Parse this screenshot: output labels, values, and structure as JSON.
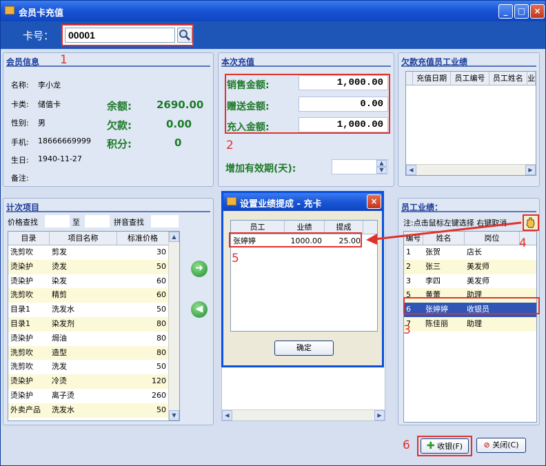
{
  "window": {
    "title": "会员卡充值",
    "min": "_",
    "max": "□",
    "close": "×"
  },
  "card": {
    "label": "卡号：",
    "value": "00001"
  },
  "member": {
    "header": "会员信息",
    "name": {
      "label": "名称:",
      "value": "李小龙"
    },
    "type": {
      "label": "卡类:",
      "value": "储值卡"
    },
    "gender": {
      "label": "性别:",
      "value": "男"
    },
    "phone": {
      "label": "手机:",
      "value": "18666669999"
    },
    "birthday": {
      "label": "生日:",
      "value": "1940-11-27"
    },
    "note": {
      "label": "备注:"
    },
    "balance": {
      "label": "余额:",
      "value": "2690.00"
    },
    "debt": {
      "label": "欠款:",
      "value": "0.00"
    },
    "points": {
      "label": "积分:",
      "value": "0"
    }
  },
  "recharge": {
    "header": "本次充值",
    "sales": {
      "label": "销售金额:",
      "value": "1,000.00"
    },
    "gift": {
      "label": "赠送金额:",
      "value": "0.00"
    },
    "credit": {
      "label": "充入金额:",
      "value": "1,000.00"
    },
    "validity_label": "增加有效期(天):",
    "validity_value": ""
  },
  "arrears": {
    "header": "欠款充值员工业绩",
    "columns": [
      "充值日期",
      "员工编号",
      "员工姓名",
      "业"
    ]
  },
  "items": {
    "header": "计次项目",
    "price_search": "价格查找",
    "to": "至",
    "pinyin_search": "拼音查找",
    "columns": [
      "目录",
      "项目名称",
      "标准价格"
    ],
    "rows": [
      [
        "洗剪吹",
        "剪发",
        "30"
      ],
      [
        "烫染护",
        "烫发",
        "50"
      ],
      [
        "烫染护",
        "染发",
        "60"
      ],
      [
        "洗剪吹",
        "精剪",
        "60"
      ],
      [
        "目录1",
        "洗发水",
        "50"
      ],
      [
        "目录1",
        "染发剂",
        "80"
      ],
      [
        "烫染护",
        "焗油",
        "80"
      ],
      [
        "洗剪吹",
        "造型",
        "80"
      ],
      [
        "洗剪吹",
        "洗发",
        "50"
      ],
      [
        "烫染护",
        "冷烫",
        "120"
      ],
      [
        "烫染护",
        "离子烫",
        "260"
      ],
      [
        "外卖产品",
        "洗发水",
        "50"
      ]
    ]
  },
  "staff": {
    "header": "员工业绩：",
    "hint": "注:点击鼠标左键选择 右键取消",
    "columns": [
      "编号",
      "姓名",
      "岗位"
    ],
    "rows": [
      [
        "1",
        "张贺",
        "店长"
      ],
      [
        "2",
        "张三",
        "美发师"
      ],
      [
        "3",
        "李四",
        "美发师"
      ],
      [
        "5",
        "黄蕾",
        "助理"
      ],
      [
        "6",
        "张婷婷",
        "收银员"
      ],
      [
        "7",
        "陈佳丽",
        "助理"
      ]
    ]
  },
  "dialog": {
    "title": "设置业绩提成 - 充卡",
    "columns": [
      "员工",
      "业绩",
      "提成"
    ],
    "row": [
      "张婷婷",
      "1000.00",
      "25.00"
    ],
    "ok": "确定"
  },
  "buttons": {
    "cashier": "收银(F)",
    "close": "关闭(C)"
  },
  "markers": [
    "1",
    "2",
    "3",
    "4",
    "5",
    "6"
  ]
}
